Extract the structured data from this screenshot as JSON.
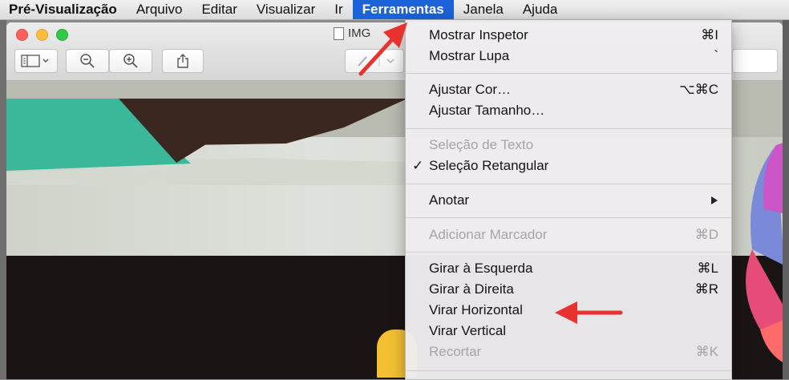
{
  "menubar": {
    "app": "Pré-Visualização",
    "items": [
      "Arquivo",
      "Editar",
      "Visualizar",
      "Ir"
    ],
    "active": "Ferramentas",
    "after": [
      "Janela",
      "Ajuda"
    ]
  },
  "window": {
    "title": "IMG"
  },
  "menu": {
    "items": [
      {
        "label": "Mostrar Inspetor",
        "shortcut": "⌘I"
      },
      {
        "label": "Mostrar Lupa",
        "shortcut": "`"
      },
      {
        "label": "Ajustar Cor…",
        "shortcut": "⌥⌘C"
      },
      {
        "label": "Ajustar Tamanho…",
        "shortcut": ""
      },
      {
        "label": "Seleção de Texto",
        "shortcut": ""
      },
      {
        "label": "Seleção Retangular",
        "shortcut": "",
        "check": "✓"
      },
      {
        "label": "Anotar",
        "shortcut": ""
      },
      {
        "label": "Adicionar Marcador",
        "shortcut": "⌘D"
      },
      {
        "label": "Girar à Esquerda",
        "shortcut": "⌘L"
      },
      {
        "label": "Girar à Direita",
        "shortcut": "⌘R"
      },
      {
        "label": "Virar Horizontal",
        "shortcut": ""
      },
      {
        "label": "Virar Vertical",
        "shortcut": ""
      },
      {
        "label": "Recortar",
        "shortcut": "⌘K"
      }
    ]
  },
  "colors": {
    "menu_highlight": "#1c62d8",
    "annotation_arrow": "#e8322f"
  }
}
